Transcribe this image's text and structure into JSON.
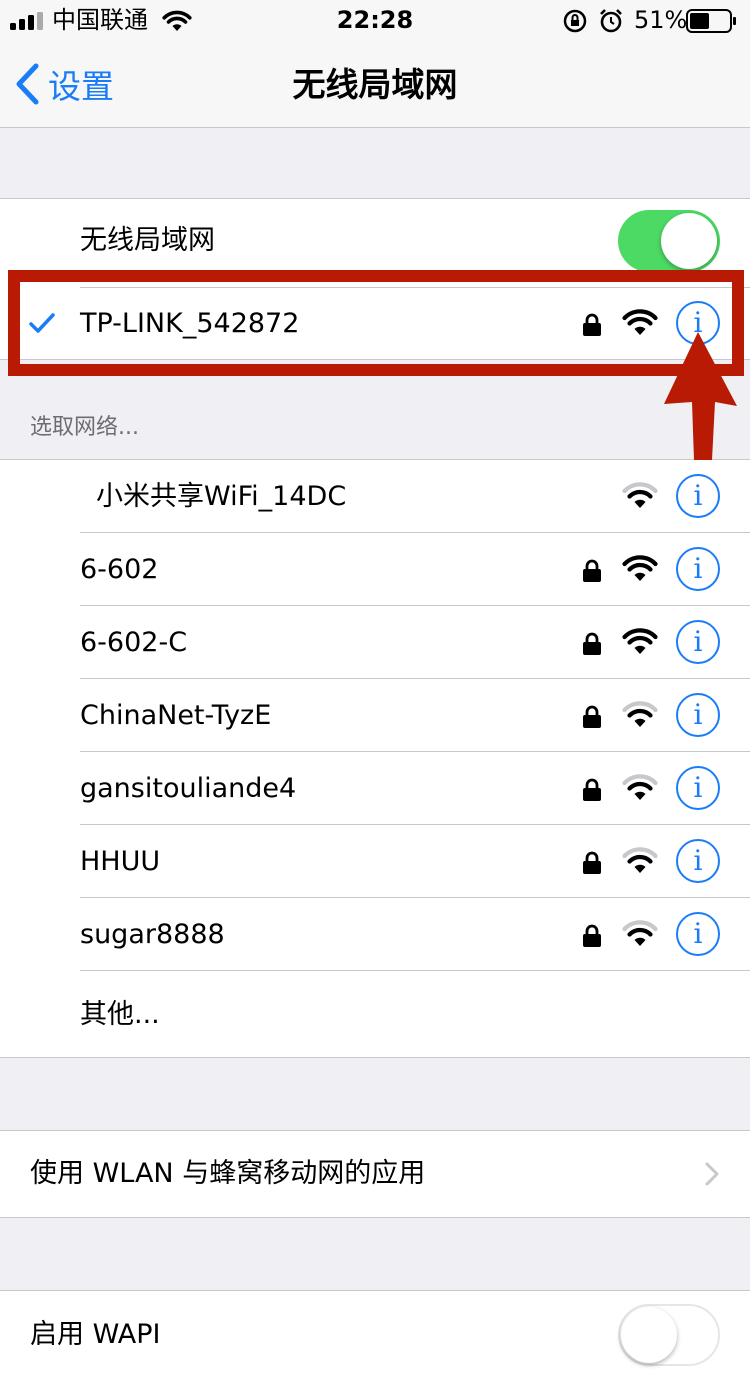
{
  "status_bar": {
    "carrier": "中国联通",
    "time": "22:28",
    "battery_percent": "51%",
    "battery_level": 0.51
  },
  "nav": {
    "back_label": "设置",
    "title": "无线局域网"
  },
  "wifi_toggle": {
    "label": "无线局域网",
    "on": true
  },
  "connected_network": {
    "name": "TP-LINK_542872",
    "locked": true,
    "signal": "full"
  },
  "choose_network_header": "选取网络...",
  "networks": [
    {
      "name": "小米共享WiFi_14DC",
      "locked": false,
      "signal": "weak"
    },
    {
      "name": "6-602",
      "locked": true,
      "signal": "full"
    },
    {
      "name": "6-602-C",
      "locked": true,
      "signal": "full"
    },
    {
      "name": "ChinaNet-TyzE",
      "locked": true,
      "signal": "weak"
    },
    {
      "name": "gansitouliande4",
      "locked": true,
      "signal": "weak"
    },
    {
      "name": "HHUU",
      "locked": true,
      "signal": "weak"
    },
    {
      "name": "sugar8888",
      "locked": true,
      "signal": "weak"
    }
  ],
  "other_label": "其他...",
  "apps_row_label": "使用 WLAN 与蜂窝移动网的应用",
  "wapi_label": "启用 WAPI",
  "info_glyph": "i",
  "icons": {
    "lock": "lock-icon",
    "wifi": "wifi-icon",
    "info": "info-icon",
    "checkmark": "checkmark-icon",
    "chevron": "chevron-right-icon"
  },
  "colors": {
    "accent": "#1a7df7",
    "toggle_on": "#4cd964",
    "annotation": "#b81a04"
  }
}
